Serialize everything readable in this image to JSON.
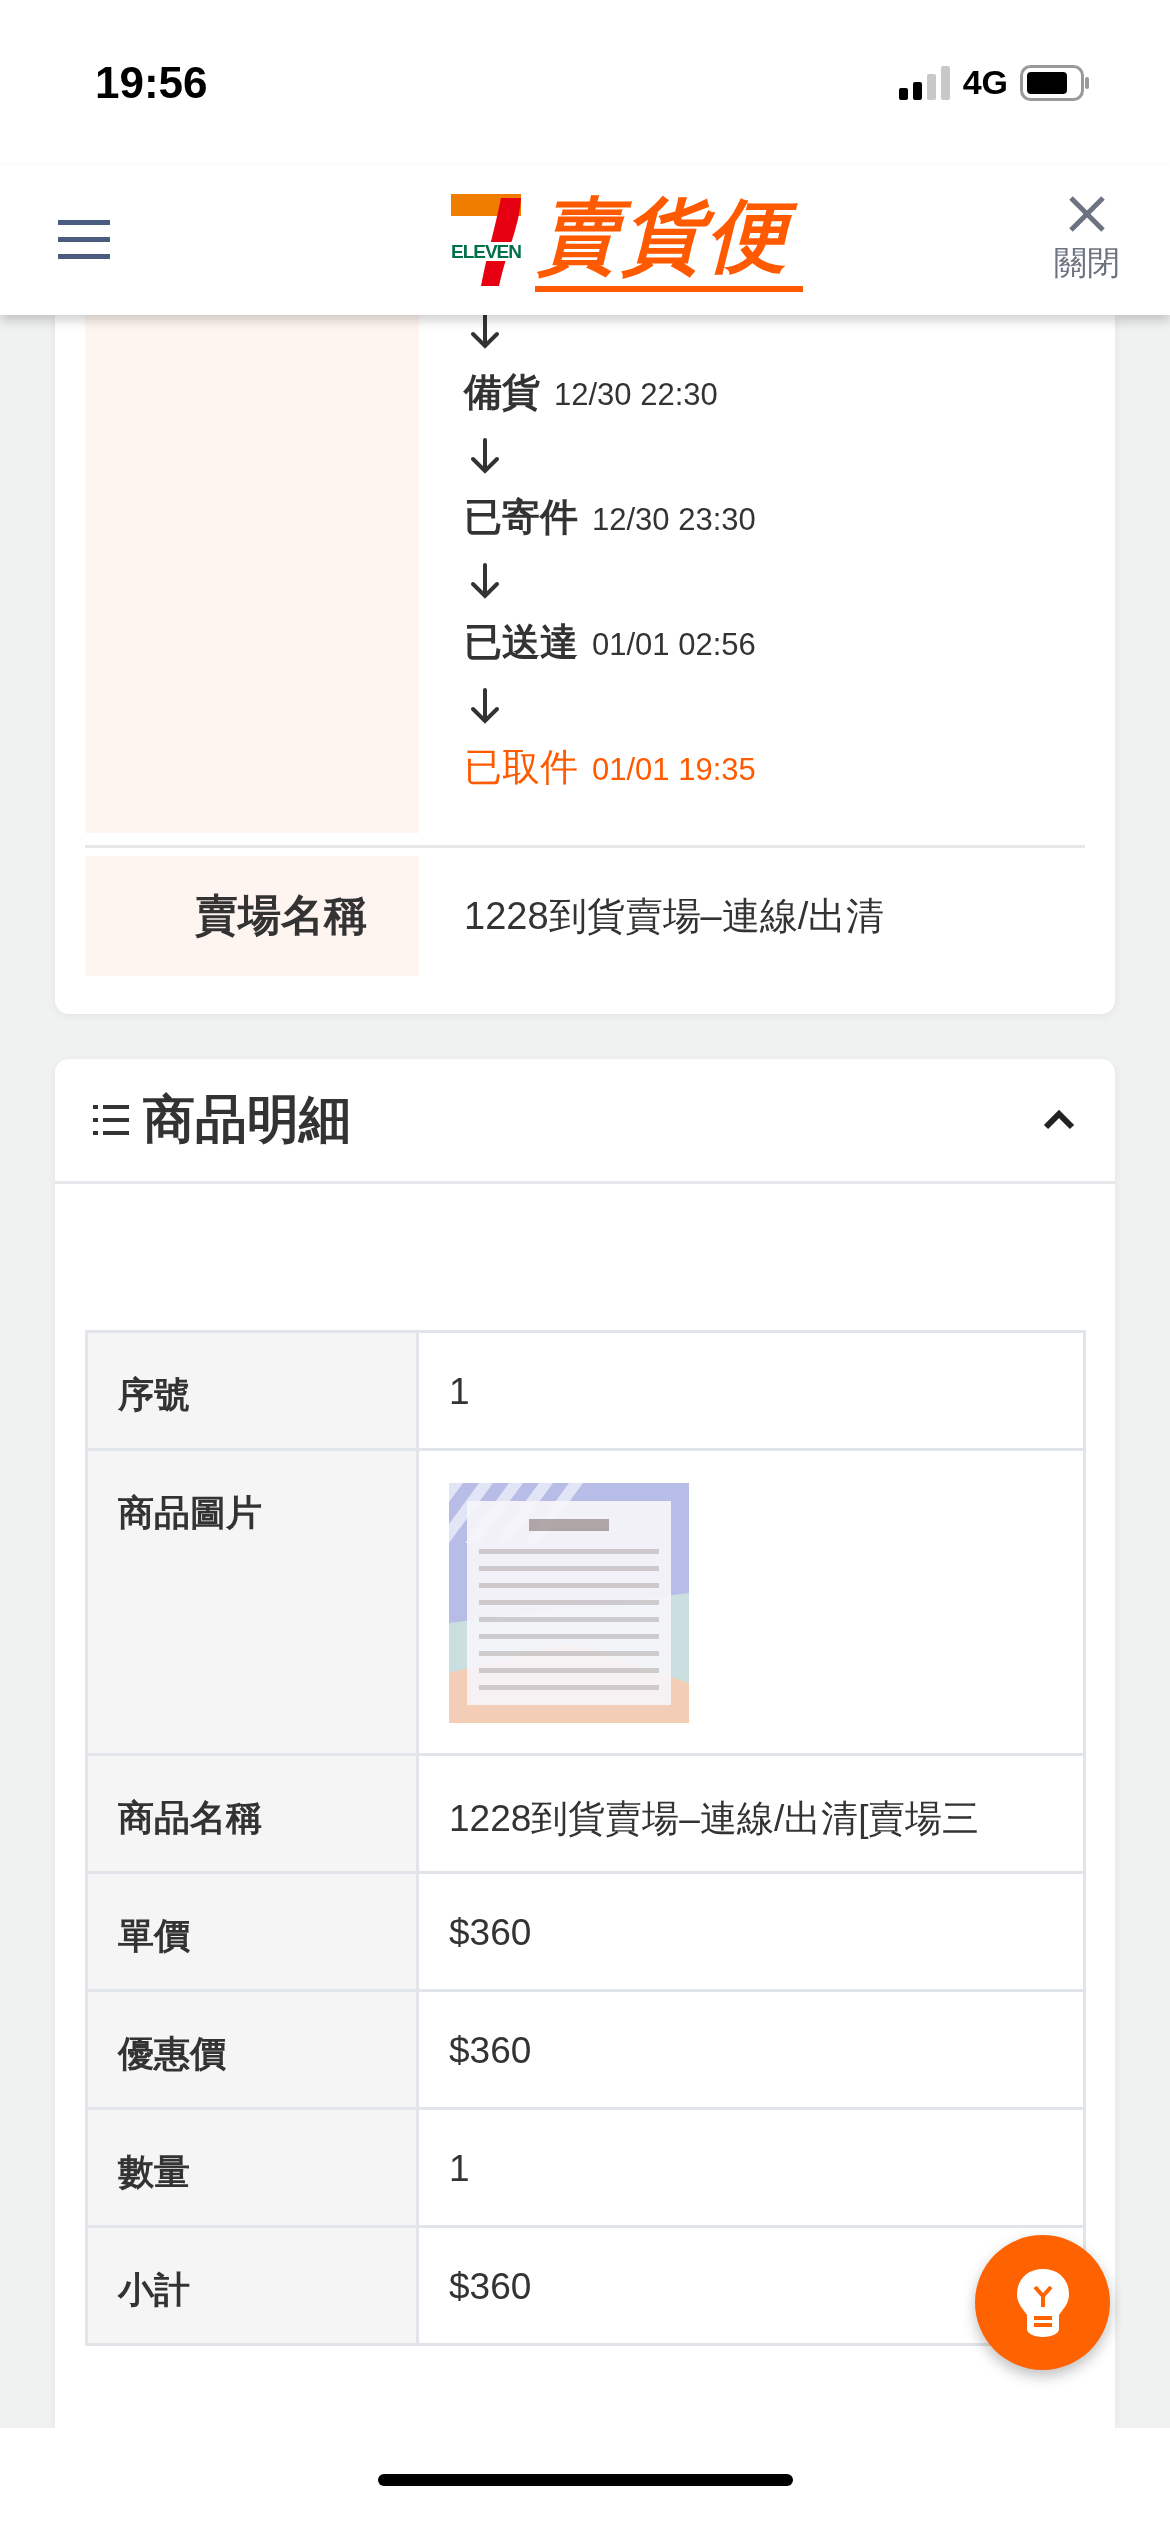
{
  "status_bar": {
    "time": "19:56",
    "network": "4G"
  },
  "header": {
    "logo": {
      "brand": "ELEVEN",
      "name": "賣貨便"
    },
    "close_label": "關閉"
  },
  "order_card": {
    "timeline": [
      {
        "status": "備貨",
        "time": "12/30 22:30",
        "current": false
      },
      {
        "status": "已寄件",
        "time": "12/30 23:30",
        "current": false
      },
      {
        "status": "已送達",
        "time": "01/01 02:56",
        "current": false
      },
      {
        "status": "已取件",
        "time": "01/01 19:35",
        "current": true
      }
    ],
    "store": {
      "label": "賣場名稱",
      "value": "1228到貨賣場–連線/出清"
    }
  },
  "details": {
    "title": "商品明細",
    "expanded": true,
    "rows": [
      {
        "kind": "text",
        "label": "序號",
        "value": "1"
      },
      {
        "label": "商品圖片"
      },
      {
        "kind": "text",
        "label": "商品名稱",
        "value": "1228到貨賣場–連線/出清[賣場三"
      },
      {
        "kind": "text",
        "label": "單價",
        "value": "$360"
      },
      {
        "kind": "text",
        "label": "優惠價",
        "value": "$360"
      },
      {
        "kind": "text",
        "label": "數量",
        "value": "1"
      },
      {
        "kind": "text",
        "label": "小計",
        "value": "$360"
      }
    ]
  }
}
